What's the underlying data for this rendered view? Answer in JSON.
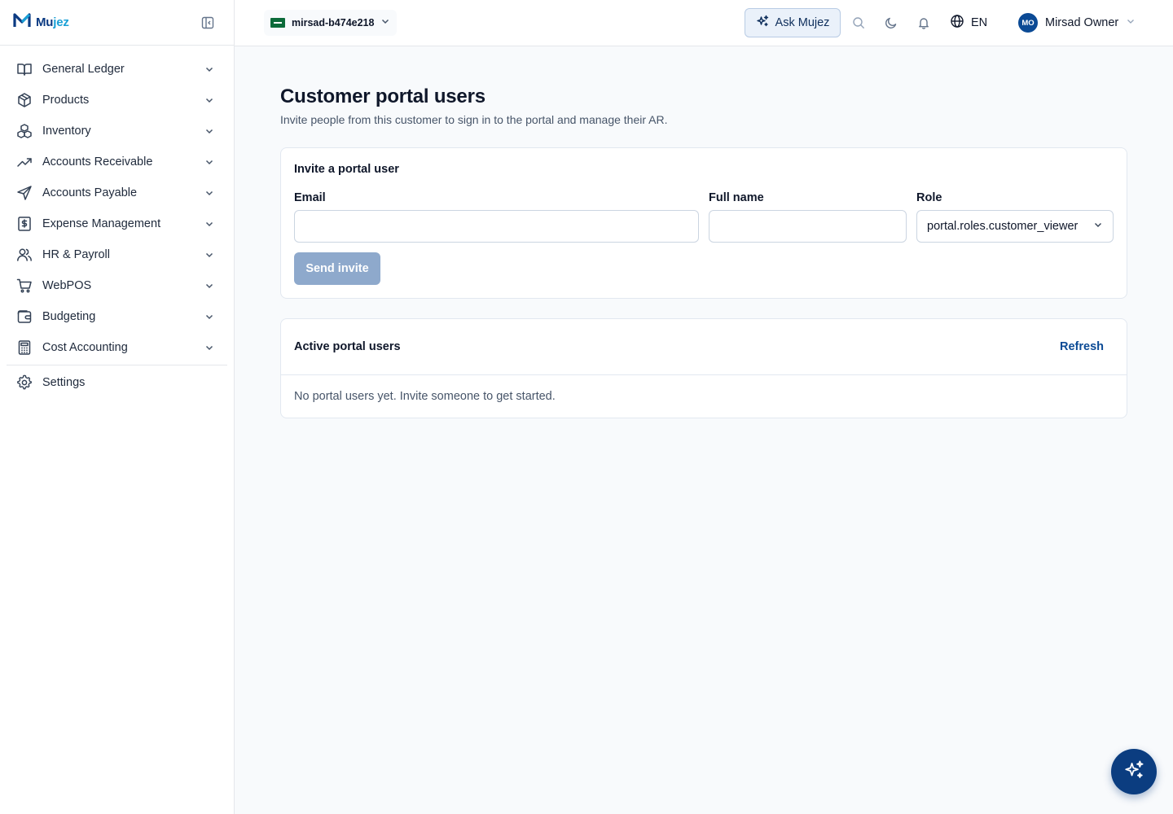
{
  "brand": {
    "name_part1": "Mu",
    "name_part2": "jez"
  },
  "sidebar": {
    "items": [
      {
        "label": "General Ledger",
        "icon": "book-open-icon"
      },
      {
        "label": "Products",
        "icon": "package-icon"
      },
      {
        "label": "Inventory",
        "icon": "boxes-icon"
      },
      {
        "label": "Accounts Receivable",
        "icon": "trending-up-icon"
      },
      {
        "label": "Accounts Payable",
        "icon": "send-icon"
      },
      {
        "label": "Expense Management",
        "icon": "receipt-dollar-icon"
      },
      {
        "label": "HR & Payroll",
        "icon": "users-icon"
      },
      {
        "label": "WebPOS",
        "icon": "shopping-cart-icon"
      },
      {
        "label": "Budgeting",
        "icon": "wallet-icon"
      },
      {
        "label": "Cost Accounting",
        "icon": "calculator-icon"
      }
    ],
    "settings_label": "Settings"
  },
  "topbar": {
    "tenant": "mirsad-b474e218",
    "ask_label": "Ask Mujez",
    "language": "EN",
    "user_initials": "MO",
    "user_name": "Mirsad Owner"
  },
  "page": {
    "title": "Customer portal users",
    "subtitle": "Invite people from this customer to sign in to the portal and manage their AR."
  },
  "invite": {
    "card_title": "Invite a portal user",
    "email_label": "Email",
    "email_value": "",
    "fullname_label": "Full name",
    "fullname_value": "",
    "role_label": "Role",
    "role_value": "portal.roles.customer_viewer",
    "send_label": "Send invite"
  },
  "users": {
    "card_title": "Active portal users",
    "refresh_label": "Refresh",
    "empty_message": "No portal users yet. Invite someone to get started."
  },
  "colors": {
    "primary": "#0b4a95",
    "brand_dark": "#0b3a82",
    "brand_light": "#1aa0d6",
    "disabled_button": "#8ea9cc"
  }
}
